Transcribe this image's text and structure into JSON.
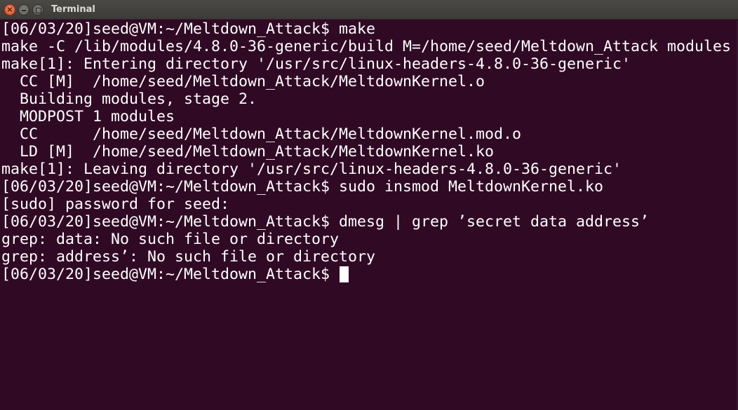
{
  "window": {
    "title": "Terminal",
    "close_glyph": "×"
  },
  "colors": {
    "background": "#300a24",
    "foreground": "#ffffff",
    "titlebar": "#3c3b37",
    "close_button": "#df4a16"
  },
  "terminal": {
    "lines": [
      "[06/03/20]seed@VM:~/Meltdown_Attack$ make",
      "make -C /lib/modules/4.8.0-36-generic/build M=/home/seed/Meltdown_Attack modules",
      "make[1]: Entering directory '/usr/src/linux-headers-4.8.0-36-generic'",
      "  CC [M]  /home/seed/Meltdown_Attack/MeltdownKernel.o",
      "  Building modules, stage 2.",
      "  MODPOST 1 modules",
      "  CC      /home/seed/Meltdown_Attack/MeltdownKernel.mod.o",
      "  LD [M]  /home/seed/Meltdown_Attack/MeltdownKernel.ko",
      "make[1]: Leaving directory '/usr/src/linux-headers-4.8.0-36-generic'",
      "[06/03/20]seed@VM:~/Meltdown_Attack$ sudo insmod MeltdownKernel.ko",
      "[sudo] password for seed: ",
      "[06/03/20]seed@VM:~/Meltdown_Attack$ dmesg | grep ’secret data address’",
      "grep: data: No such file or directory",
      "grep: address’: No such file or directory"
    ],
    "prompt": "[06/03/20]seed@VM:~/Meltdown_Attack$ "
  }
}
